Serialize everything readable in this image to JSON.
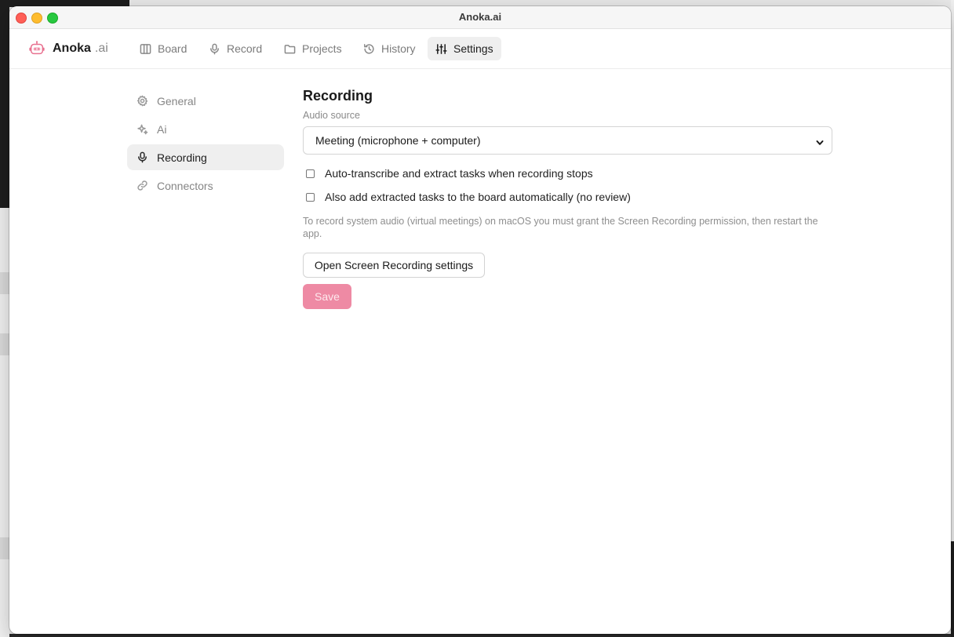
{
  "window": {
    "title": "Anoka.ai"
  },
  "brand": {
    "name": "Anoka",
    "suffix": ".ai",
    "icon": "robot-logo-icon"
  },
  "nav": {
    "items": [
      {
        "label": "Board",
        "icon": "board-columns-icon"
      },
      {
        "label": "Record",
        "icon": "microphone-icon"
      },
      {
        "label": "Projects",
        "icon": "folder-icon"
      },
      {
        "label": "History",
        "icon": "history-icon"
      },
      {
        "label": "Settings",
        "icon": "sliders-icon",
        "active": true
      }
    ]
  },
  "sidebar": {
    "items": [
      {
        "label": "General",
        "icon": "gear-icon"
      },
      {
        "label": "Ai",
        "icon": "sparkle-icon"
      },
      {
        "label": "Recording",
        "icon": "microphone-icon",
        "active": true
      },
      {
        "label": "Connectors",
        "icon": "link-icon"
      }
    ]
  },
  "recording": {
    "title": "Recording",
    "audio_source_label": "Audio source",
    "audio_source_value": "Meeting (microphone + computer)",
    "auto_transcribe_label": "Auto-transcribe and extract tasks when recording stops",
    "auto_transcribe_checked": false,
    "auto_add_label": "Also add extracted tasks to the board automatically (no review)",
    "auto_add_checked": false,
    "help_text": "To record system audio (virtual meetings) on macOS you must grant the Screen Recording permission, then restart the app.",
    "open_settings_label": "Open Screen Recording settings",
    "save_label": "Save"
  },
  "colors": {
    "accent": "#ee8aa4",
    "close": "#ff5f57",
    "minimize": "#febc2e",
    "maximize": "#28c840"
  }
}
